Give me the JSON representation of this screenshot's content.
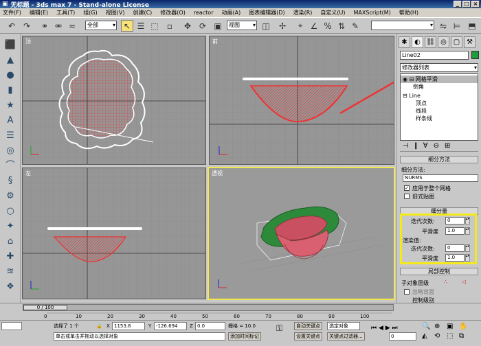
{
  "window": {
    "title": "无标题 - 3ds max 7 - Stand-alone License",
    "min": "_",
    "max": "□",
    "close": "×"
  },
  "menu": [
    "文件(F)",
    "编辑(E)",
    "工具(T)",
    "组(G)",
    "视图(V)",
    "创建(C)",
    "修改器(O)",
    "reactor",
    "动画(A)",
    "图表编辑器(D)",
    "渲染(R)",
    "自定义(U)",
    "MAXScript(M)",
    "帮助(H)"
  ],
  "toolbar": {
    "selection_filter": "全部",
    "ref_coord": "视图",
    "named_selection": ""
  },
  "viewports": [
    {
      "label": "顶"
    },
    {
      "label": "前"
    },
    {
      "label": "左"
    },
    {
      "label": "透视"
    }
  ],
  "command_panel": {
    "object_name": "Line02",
    "object_color": "#1e9c3c",
    "modifier_list": "修改器列表",
    "stack": {
      "mesh_smooth": "网格平滑",
      "corner": "倒角",
      "line": "Line",
      "vertex": "顶点",
      "segment": "线段",
      "spline": "样条线"
    },
    "subdivision_method": {
      "header": "细分方法",
      "label": "细分方法:",
      "value": "NURMS",
      "apply_to_whole_mesh": "应用于整个网格",
      "old_style_mapping": "旧式贴图"
    },
    "subdivision_amount": {
      "header": "细分量",
      "iterations_label": "迭代次数:",
      "iterations_value": "0",
      "smoothness_label": "平滑度",
      "smoothness_value": "1.0",
      "render_values": "渲染值:",
      "render_iterations_value": "0",
      "render_smoothness_value": "1.0"
    },
    "local_control": {
      "header": "局部控制",
      "sub_object_level": "子对象层级",
      "ignore_backface": "忽略背面",
      "control_level": "控制级别"
    }
  },
  "timeline": {
    "frame_label": "0 / 100",
    "ticks": [
      "0",
      "10",
      "20",
      "30",
      "40",
      "50",
      "60",
      "70",
      "80",
      "90",
      "100"
    ]
  },
  "status": {
    "selection": "选择了 1 个",
    "x_label": "X",
    "x_value": "1153.8",
    "y_label": "Y",
    "y_value": "-126.694",
    "z_label": "Z",
    "z_value": "0.0",
    "grid": "栅格 = 10.0",
    "auto_key": "自动关键点",
    "set_key": "设置关键点",
    "selected_object": "选定对象",
    "key_filters": "关键点过滤器...",
    "prompt": "单击或单击并拖动以选择对象",
    "add_time_tag": "添加时间标记",
    "frame": "0"
  }
}
